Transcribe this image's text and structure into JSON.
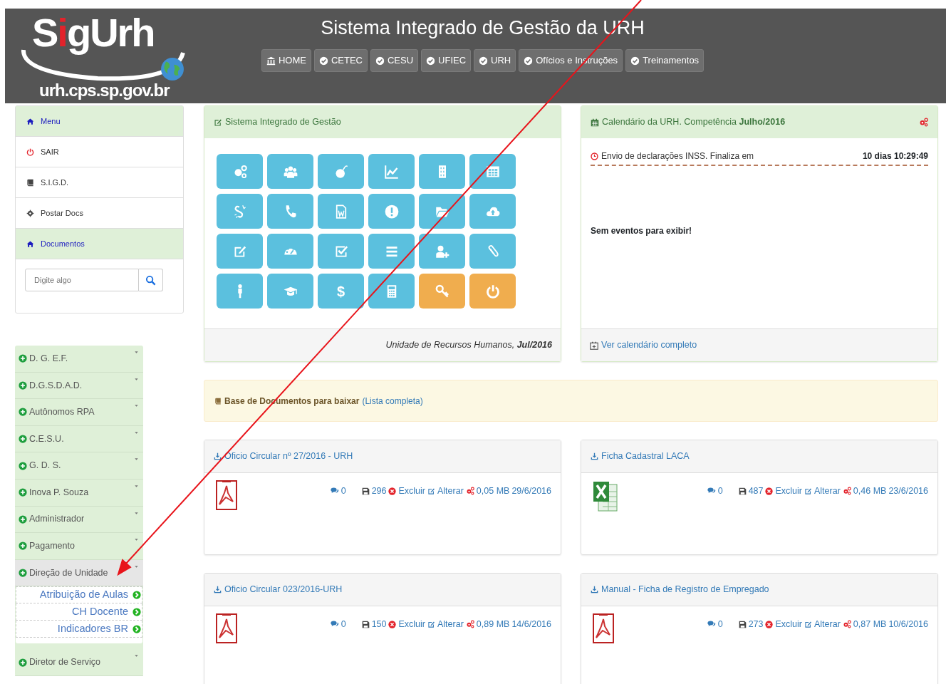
{
  "header": {
    "logo_parts": [
      {
        "text": "S",
        "color": "#ffffff"
      },
      {
        "text": "i",
        "color": "#e3232b"
      },
      {
        "text": "gUrh",
        "color": "#ffffff"
      }
    ],
    "site_url": "urh.cps.sp.gov.br",
    "title": "Sistema Integrado de Gestão da URH",
    "nav": [
      {
        "label": "HOME",
        "kind": "home"
      },
      {
        "label": "CETEC",
        "kind": "check"
      },
      {
        "label": "CESU",
        "kind": "check"
      },
      {
        "label": "UFIEC",
        "kind": "check"
      },
      {
        "label": "URH",
        "kind": "check"
      },
      {
        "label": "Ofícios e Instruções",
        "kind": "check"
      },
      {
        "label": "Treinamentos",
        "kind": "check"
      }
    ]
  },
  "sidebar": {
    "menu": [
      {
        "label": "Menu",
        "kind": "header"
      },
      {
        "label": "SAIR",
        "kind": "logout"
      },
      {
        "label": "S.I.G.D.",
        "kind": "book"
      },
      {
        "label": "Postar Docs",
        "kind": "cog"
      },
      {
        "label": "Documentos",
        "kind": "header"
      }
    ],
    "search": {
      "placeholder": "Digite algo"
    },
    "accordion": [
      {
        "label": "D. G. E.F.",
        "expanded": false
      },
      {
        "label": "D.G.S.D.A.D.",
        "expanded": false
      },
      {
        "label": "Autônomos RPA",
        "expanded": false
      },
      {
        "label": "C.E.S.U.",
        "expanded": false
      },
      {
        "label": "G. D. S.",
        "expanded": false
      },
      {
        "label": "Inova P. Souza",
        "expanded": false
      },
      {
        "label": "Administrador",
        "expanded": false
      },
      {
        "label": "Pagamento",
        "expanded": false
      },
      {
        "label": "Direção de Unidade",
        "expanded": true,
        "children": [
          {
            "label": "Atribuição de Aulas"
          },
          {
            "label": "CH Docente"
          },
          {
            "label": "Indicadores BR"
          }
        ]
      },
      {
        "label": "Diretor de Serviço",
        "expanded": false
      }
    ]
  },
  "system_panel": {
    "title": "Sistema Integrado de Gestão",
    "tiles": [
      {
        "color": "#5bc0de"
      },
      {
        "color": "#5bc0de"
      },
      {
        "color": "#5bc0de"
      },
      {
        "color": "#5bc0de"
      },
      {
        "color": "#5bc0de"
      },
      {
        "color": "#5bc0de"
      },
      {
        "color": "#5bc0de"
      },
      {
        "color": "#5bc0de"
      },
      {
        "color": "#5bc0de"
      },
      {
        "color": "#5bc0de"
      },
      {
        "color": "#5bc0de"
      },
      {
        "color": "#5bc0de"
      },
      {
        "color": "#5bc0de"
      },
      {
        "color": "#5bc0de"
      },
      {
        "color": "#5bc0de"
      },
      {
        "color": "#5bc0de"
      },
      {
        "color": "#5bc0de"
      },
      {
        "color": "#5bc0de"
      },
      {
        "color": "#5bc0de"
      },
      {
        "color": "#5bc0de"
      },
      {
        "color": "#5bc0de",
        "glyph": "$"
      },
      {
        "color": "#5bc0de"
      },
      {
        "color": "#f0ad4e"
      },
      {
        "color": "#f0ad4e"
      }
    ],
    "footer": "Unidade de Recursos Humanos, **Jul/2016**"
  },
  "calendar": {
    "title": "Calendário da URH. Competência **Julho/2016**",
    "event": {
      "text": "Envio de declarações INSS. Finaliza em",
      "countdown": "10 dias 10:29:49"
    },
    "empty_message": "Sem eventos para exibir!",
    "footer_link": "Ver calendário completo"
  },
  "documents_banner": {
    "title": "Base de Documentos para baixar",
    "link": "(Lista completa)"
  },
  "documents": [
    {
      "title": "Oficio Circular nº 27/2016 - URH",
      "kind": "pdf",
      "comments": "0",
      "downloads": "296",
      "delete_label": "Excluir",
      "edit_label": "Alterar",
      "size": "0,05 MB",
      "date": "29/6/2016"
    },
    {
      "title": "Ficha Cadastral LACA",
      "kind": "excel",
      "comments": "0",
      "downloads": "487",
      "delete_label": "Excluir",
      "edit_label": "Alterar",
      "size": "0,46 MB",
      "date": "23/6/2016"
    },
    {
      "title": "Oficio Circular 023/2016-URH",
      "kind": "pdf",
      "comments": "0",
      "downloads": "150",
      "delete_label": "Excluir",
      "edit_label": "Alterar",
      "size": "0,89 MB",
      "date": "14/6/2016"
    },
    {
      "title": "Manual - Ficha de Registro de Empregado",
      "kind": "pdf",
      "comments": "0",
      "downloads": "273",
      "delete_label": "Excluir",
      "edit_label": "Alterar",
      "size": "0,87 MB",
      "date": "10/6/2016"
    }
  ]
}
